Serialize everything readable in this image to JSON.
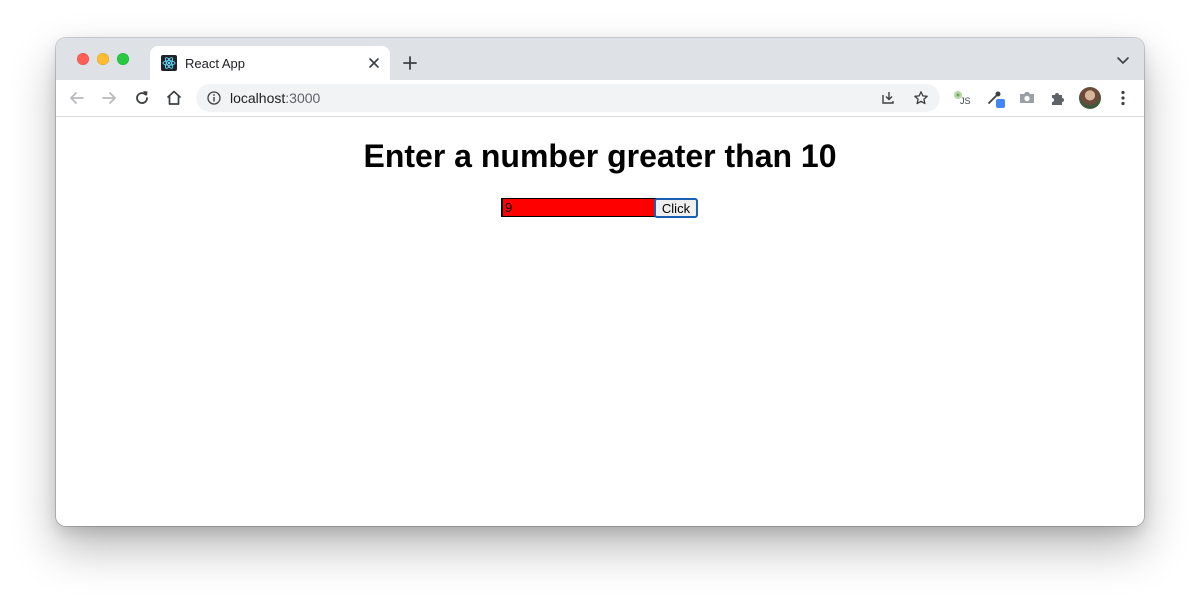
{
  "browser": {
    "tab": {
      "title": "React App",
      "favicon": "react-logo-icon"
    },
    "address_bar": {
      "host": "localhost",
      "port": ":3000"
    },
    "toolbar_icons": [
      "back-icon",
      "forward-icon",
      "reload-icon",
      "home-icon",
      "info-icon",
      "install-icon",
      "bookmark-star-icon",
      "js-extension-icon",
      "eyedropper-extension-icon",
      "camera-extension-icon",
      "extensions-puzzle-icon",
      "profile-avatar",
      "kebab-menu-icon"
    ]
  },
  "page": {
    "heading": "Enter a number greater than 10",
    "input_value": "9",
    "button_label": "Click"
  },
  "colors": {
    "input_background": "#ff0000",
    "button_border": "#1a5fb4",
    "tab_strip": "#dee1e6"
  }
}
